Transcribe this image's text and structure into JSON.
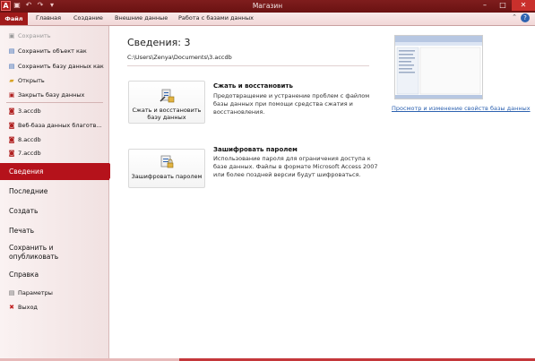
{
  "window": {
    "title": "Магазин",
    "app_logo": "A",
    "qat_icons": [
      "save-icon",
      "undo-icon",
      "redo-icon",
      "dropdown-icon"
    ],
    "controls": [
      "minimize",
      "maximize",
      "close"
    ]
  },
  "ribbon": {
    "tabs": [
      {
        "label": "Файл",
        "active": true
      },
      {
        "label": "Главная"
      },
      {
        "label": "Создание"
      },
      {
        "label": "Внешние данные"
      },
      {
        "label": "Работа с базами данных"
      }
    ]
  },
  "backstage": {
    "commands": [
      {
        "label": "Сохранить",
        "icon": "save-icon",
        "disabled": true
      },
      {
        "label": "Сохранить объект как",
        "icon": "save-as-icon"
      },
      {
        "label": "Сохранить базу данных как",
        "icon": "save-db-icon"
      },
      {
        "label": "Открыть",
        "icon": "open-folder-icon"
      },
      {
        "label": "Закрыть базу данных",
        "icon": "close-db-icon"
      }
    ],
    "recent": [
      {
        "label": "3.accdb"
      },
      {
        "label": "Веб-база данных благотв..."
      },
      {
        "label": "8.accdb"
      },
      {
        "label": "7.accdb"
      }
    ],
    "nav": {
      "selected": "Сведения",
      "items": [
        "Последние",
        "Создать",
        "Печать",
        "Сохранить и",
        "опубликовать",
        "Справка"
      ]
    },
    "bottom": [
      {
        "label": "Параметры",
        "icon": "options-icon"
      },
      {
        "label": "Выход",
        "icon": "exit-icon"
      }
    ]
  },
  "info": {
    "title": "Сведения: 3",
    "path": "C:\\Users\\Zenya\\Documents\\3.accdb",
    "compact": {
      "button_label": "Сжать и восстановить базу данных",
      "heading": "Сжать и восстановить",
      "description": "Предотвращение и устранение проблем с файлом базы данных при помощи средства сжатия и восстановления."
    },
    "encrypt": {
      "button_label": "Зашифровать паролем",
      "heading": "Зашифровать паролем",
      "description": "Использование пароля для ограничения доступа к базе данных. Файлы в формате Microsoft Access 2007 или более поздней версии будут шифроваться."
    },
    "properties_link": "Просмотр и изменение свойств базы данных"
  }
}
